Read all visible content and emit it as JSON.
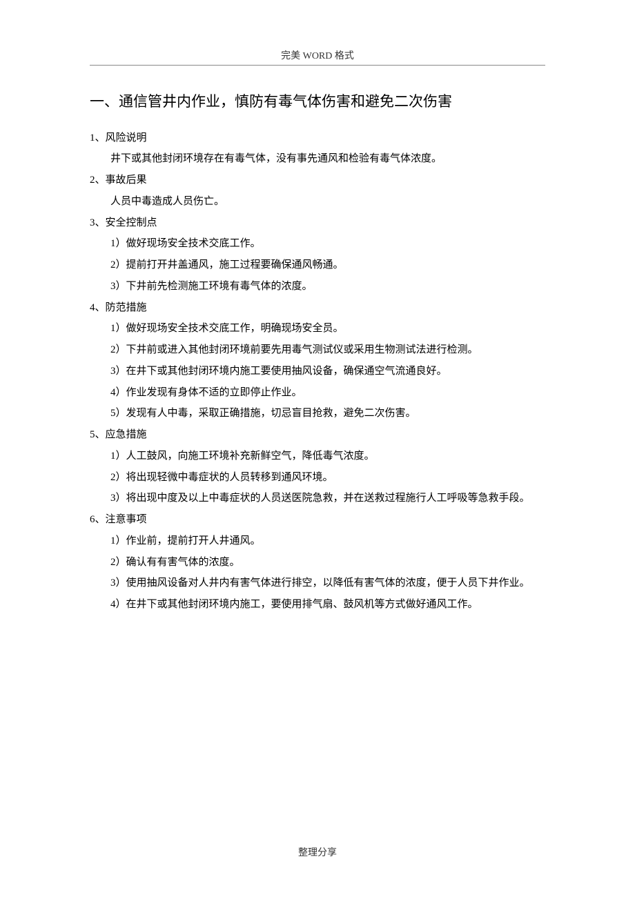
{
  "header": "完美 WORD 格式",
  "footer": "整理分享",
  "title": "一、通信管井内作业，慎防有毒气体伤害和避免二次伤害",
  "sections": [
    {
      "heading": "1、风险说明",
      "items": [
        "井下或其他封闭环境存在有毒气体，没有事先通风和检验有毒气体浓度。"
      ]
    },
    {
      "heading": "2、事故后果",
      "items": [
        "人员中毒造成人员伤亡。"
      ]
    },
    {
      "heading": "3、安全控制点",
      "items": [
        "1）做好现场安全技术交底工作。",
        "2）提前打开井盖通风，施工过程要确保通风畅通。",
        "3）下井前先检测施工环境有毒气体的浓度。"
      ]
    },
    {
      "heading": "4、防范措施",
      "items": [
        "1）做好现场安全技术交底工作，明确现场安全员。",
        "2）下井前或进入其他封闭环境前要先用毒气测试仪或采用生物测试法进行检测。",
        "3）在井下或其他封闭环境内施工要使用抽风设备，确保通空气流通良好。",
        "4）作业发现有身体不适的立即停止作业。",
        "5）发现有人中毒，采取正确措施，切忌盲目抢救，避免二次伤害。"
      ]
    },
    {
      "heading": "5、应急措施",
      "items": [
        "1）人工鼓风，向施工环境补充新鲜空气，降低毒气浓度。",
        "2）将出现轻微中毒症状的人员转移到通风环境。",
        "3）将出现中度及以上中毒症状的人员送医院急救，并在送救过程施行人工呼吸等急救手段。"
      ]
    },
    {
      "heading": "6、注意事项",
      "items": [
        "1）作业前，提前打开人井通风。",
        "2）确认有有害气体的浓度。",
        "3）使用抽风设备对人井内有害气体进行排空，以降低有害气体的浓度，便于人员下井作业。",
        "4）在井下或其他封闭环境内施工，要使用排气扇、鼓风机等方式做好通风工作。"
      ]
    }
  ]
}
